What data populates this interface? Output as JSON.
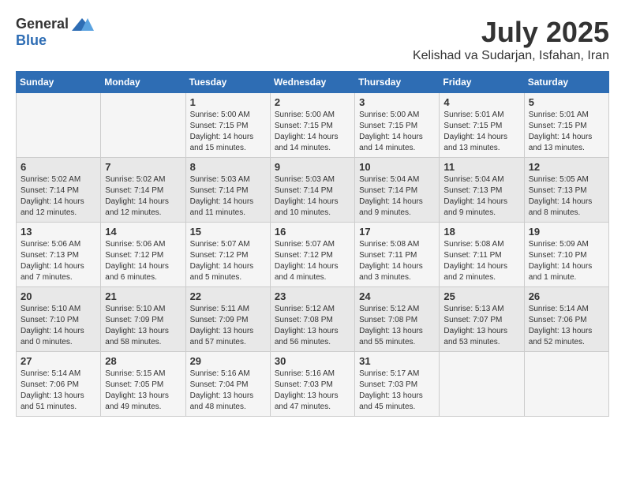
{
  "header": {
    "logo_general": "General",
    "logo_blue": "Blue",
    "month_title": "July 2025",
    "location": "Kelishad va Sudarjan, Isfahan, Iran"
  },
  "days_of_week": [
    "Sunday",
    "Monday",
    "Tuesday",
    "Wednesday",
    "Thursday",
    "Friday",
    "Saturday"
  ],
  "weeks": [
    [
      {
        "day": "",
        "info": ""
      },
      {
        "day": "",
        "info": ""
      },
      {
        "day": "1",
        "info": "Sunrise: 5:00 AM\nSunset: 7:15 PM\nDaylight: 14 hours\nand 15 minutes."
      },
      {
        "day": "2",
        "info": "Sunrise: 5:00 AM\nSunset: 7:15 PM\nDaylight: 14 hours\nand 14 minutes."
      },
      {
        "day": "3",
        "info": "Sunrise: 5:00 AM\nSunset: 7:15 PM\nDaylight: 14 hours\nand 14 minutes."
      },
      {
        "day": "4",
        "info": "Sunrise: 5:01 AM\nSunset: 7:15 PM\nDaylight: 14 hours\nand 13 minutes."
      },
      {
        "day": "5",
        "info": "Sunrise: 5:01 AM\nSunset: 7:15 PM\nDaylight: 14 hours\nand 13 minutes."
      }
    ],
    [
      {
        "day": "6",
        "info": "Sunrise: 5:02 AM\nSunset: 7:14 PM\nDaylight: 14 hours\nand 12 minutes."
      },
      {
        "day": "7",
        "info": "Sunrise: 5:02 AM\nSunset: 7:14 PM\nDaylight: 14 hours\nand 12 minutes."
      },
      {
        "day": "8",
        "info": "Sunrise: 5:03 AM\nSunset: 7:14 PM\nDaylight: 14 hours\nand 11 minutes."
      },
      {
        "day": "9",
        "info": "Sunrise: 5:03 AM\nSunset: 7:14 PM\nDaylight: 14 hours\nand 10 minutes."
      },
      {
        "day": "10",
        "info": "Sunrise: 5:04 AM\nSunset: 7:14 PM\nDaylight: 14 hours\nand 9 minutes."
      },
      {
        "day": "11",
        "info": "Sunrise: 5:04 AM\nSunset: 7:13 PM\nDaylight: 14 hours\nand 9 minutes."
      },
      {
        "day": "12",
        "info": "Sunrise: 5:05 AM\nSunset: 7:13 PM\nDaylight: 14 hours\nand 8 minutes."
      }
    ],
    [
      {
        "day": "13",
        "info": "Sunrise: 5:06 AM\nSunset: 7:13 PM\nDaylight: 14 hours\nand 7 minutes."
      },
      {
        "day": "14",
        "info": "Sunrise: 5:06 AM\nSunset: 7:12 PM\nDaylight: 14 hours\nand 6 minutes."
      },
      {
        "day": "15",
        "info": "Sunrise: 5:07 AM\nSunset: 7:12 PM\nDaylight: 14 hours\nand 5 minutes."
      },
      {
        "day": "16",
        "info": "Sunrise: 5:07 AM\nSunset: 7:12 PM\nDaylight: 14 hours\nand 4 minutes."
      },
      {
        "day": "17",
        "info": "Sunrise: 5:08 AM\nSunset: 7:11 PM\nDaylight: 14 hours\nand 3 minutes."
      },
      {
        "day": "18",
        "info": "Sunrise: 5:08 AM\nSunset: 7:11 PM\nDaylight: 14 hours\nand 2 minutes."
      },
      {
        "day": "19",
        "info": "Sunrise: 5:09 AM\nSunset: 7:10 PM\nDaylight: 14 hours\nand 1 minute."
      }
    ],
    [
      {
        "day": "20",
        "info": "Sunrise: 5:10 AM\nSunset: 7:10 PM\nDaylight: 14 hours\nand 0 minutes."
      },
      {
        "day": "21",
        "info": "Sunrise: 5:10 AM\nSunset: 7:09 PM\nDaylight: 13 hours\nand 58 minutes."
      },
      {
        "day": "22",
        "info": "Sunrise: 5:11 AM\nSunset: 7:09 PM\nDaylight: 13 hours\nand 57 minutes."
      },
      {
        "day": "23",
        "info": "Sunrise: 5:12 AM\nSunset: 7:08 PM\nDaylight: 13 hours\nand 56 minutes."
      },
      {
        "day": "24",
        "info": "Sunrise: 5:12 AM\nSunset: 7:08 PM\nDaylight: 13 hours\nand 55 minutes."
      },
      {
        "day": "25",
        "info": "Sunrise: 5:13 AM\nSunset: 7:07 PM\nDaylight: 13 hours\nand 53 minutes."
      },
      {
        "day": "26",
        "info": "Sunrise: 5:14 AM\nSunset: 7:06 PM\nDaylight: 13 hours\nand 52 minutes."
      }
    ],
    [
      {
        "day": "27",
        "info": "Sunrise: 5:14 AM\nSunset: 7:06 PM\nDaylight: 13 hours\nand 51 minutes."
      },
      {
        "day": "28",
        "info": "Sunrise: 5:15 AM\nSunset: 7:05 PM\nDaylight: 13 hours\nand 49 minutes."
      },
      {
        "day": "29",
        "info": "Sunrise: 5:16 AM\nSunset: 7:04 PM\nDaylight: 13 hours\nand 48 minutes."
      },
      {
        "day": "30",
        "info": "Sunrise: 5:16 AM\nSunset: 7:03 PM\nDaylight: 13 hours\nand 47 minutes."
      },
      {
        "day": "31",
        "info": "Sunrise: 5:17 AM\nSunset: 7:03 PM\nDaylight: 13 hours\nand 45 minutes."
      },
      {
        "day": "",
        "info": ""
      },
      {
        "day": "",
        "info": ""
      }
    ]
  ]
}
